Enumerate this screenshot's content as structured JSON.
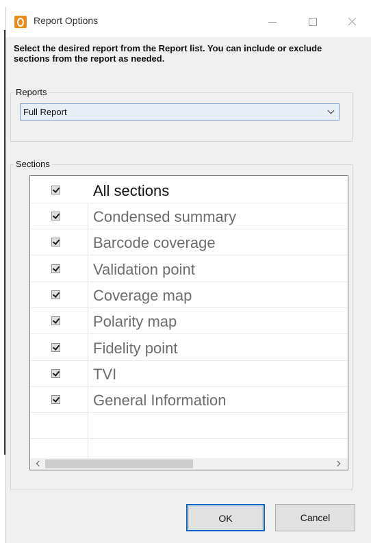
{
  "window": {
    "title": "Report Options",
    "instructions": "Select the desired report from the Report list. You can include or exclude sections from the report as needed."
  },
  "reports": {
    "group_label": "Reports",
    "selected": "Full Report"
  },
  "sections": {
    "group_label": "Sections",
    "items": [
      {
        "label": "All sections",
        "checked": true
      },
      {
        "label": "Condensed summary",
        "checked": true
      },
      {
        "label": "Barcode coverage",
        "checked": true
      },
      {
        "label": "Validation point",
        "checked": true
      },
      {
        "label": "Coverage map",
        "checked": true
      },
      {
        "label": "Polarity map",
        "checked": true
      },
      {
        "label": "Fidelity point",
        "checked": true
      },
      {
        "label": "TVI",
        "checked": true
      },
      {
        "label": "General Information",
        "checked": true
      }
    ]
  },
  "buttons": {
    "ok": "OK",
    "cancel": "Cancel"
  },
  "colors": {
    "accent": "#0b64c7",
    "app_icon": "#f08a1c"
  }
}
